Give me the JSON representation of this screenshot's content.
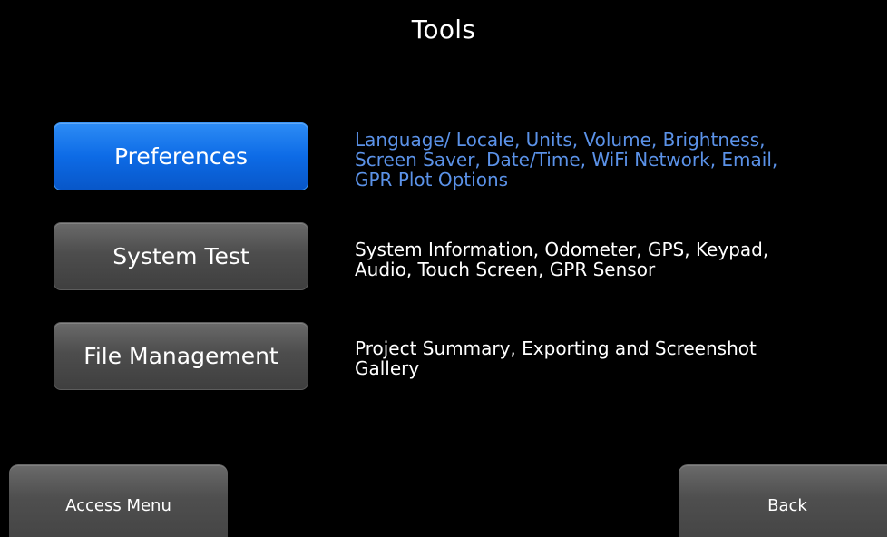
{
  "header": {
    "title": "Tools"
  },
  "options": [
    {
      "label": "Preferences",
      "selected": true,
      "description_lines": [
        "Language/ Locale, Units, Volume, Brightness,",
        "Screen Saver, Date/Time, WiFi Network, Email,",
        "GPR Plot Options"
      ]
    },
    {
      "label": "System Test",
      "selected": false,
      "description_lines": [
        "System Information, Odometer, GPS, Keypad,",
        "Audio, Touch Screen, GPR Sensor"
      ]
    },
    {
      "label": "File Management",
      "selected": false,
      "description_lines": [
        "Project Summary, Exporting and Screenshot",
        "Gallery"
      ]
    }
  ],
  "footer": {
    "left_label": "Access Menu",
    "right_label": "Back"
  },
  "colors": {
    "background": "#000000",
    "selected_button": "#0d6be6",
    "selected_description": "#5b92e8",
    "button_gray": "#4d4d4d",
    "text": "#ffffff"
  }
}
